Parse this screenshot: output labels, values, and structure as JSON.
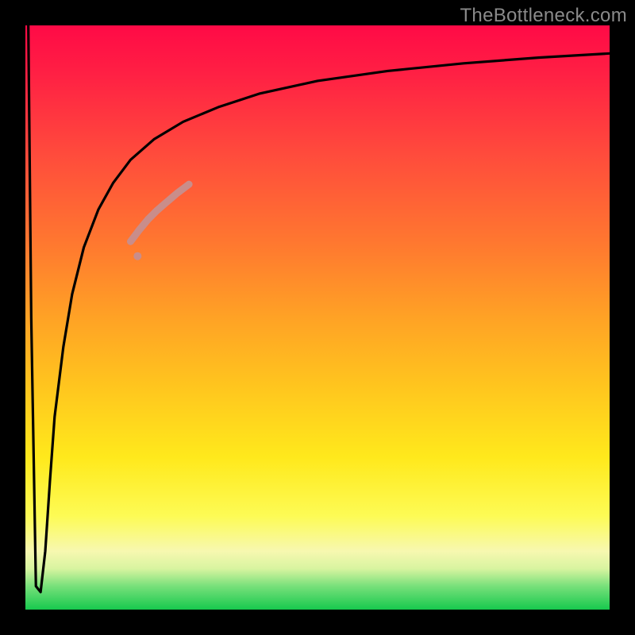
{
  "watermark": "TheBottleneck.com",
  "chart_data": {
    "type": "line",
    "title": "",
    "xlabel": "",
    "ylabel": "",
    "xlim": [
      0,
      100
    ],
    "ylim": [
      0,
      100
    ],
    "grid": false,
    "legend": false,
    "background_gradient": {
      "direction": "vertical",
      "stops": [
        {
          "pos": 0.0,
          "color": "#ff0a46"
        },
        {
          "pos": 0.22,
          "color": "#ff4b3c"
        },
        {
          "pos": 0.5,
          "color": "#ffa225"
        },
        {
          "pos": 0.74,
          "color": "#ffe91c"
        },
        {
          "pos": 0.9,
          "color": "#f7f8b0"
        },
        {
          "pos": 1.0,
          "color": "#17c94e"
        }
      ]
    },
    "series": [
      {
        "name": "curve",
        "color": "#000000",
        "x": [
          0.5,
          1.0,
          1.8,
          2.6,
          3.4,
          4.2,
          5.0,
          6.5,
          8.0,
          10.0,
          12.5,
          15.0,
          18.0,
          22.0,
          27.0,
          33.0,
          40.0,
          50.0,
          62.0,
          75.0,
          88.0,
          100.0
        ],
        "values": [
          100.0,
          50.0,
          4.0,
          3.0,
          10.0,
          22.0,
          33.0,
          45.0,
          54.0,
          62.0,
          68.5,
          73.0,
          77.0,
          80.5,
          83.5,
          86.0,
          88.3,
          90.5,
          92.2,
          93.5,
          94.5,
          95.2
        ]
      },
      {
        "name": "highlight-segment",
        "color": "#c98d8a",
        "thickness": 9,
        "x": [
          18.0,
          19.5,
          21.0,
          22.5,
          24.0,
          26.0,
          28.0
        ],
        "values": [
          63.0,
          65.0,
          66.8,
          68.3,
          69.6,
          71.3,
          72.8
        ]
      }
    ]
  }
}
